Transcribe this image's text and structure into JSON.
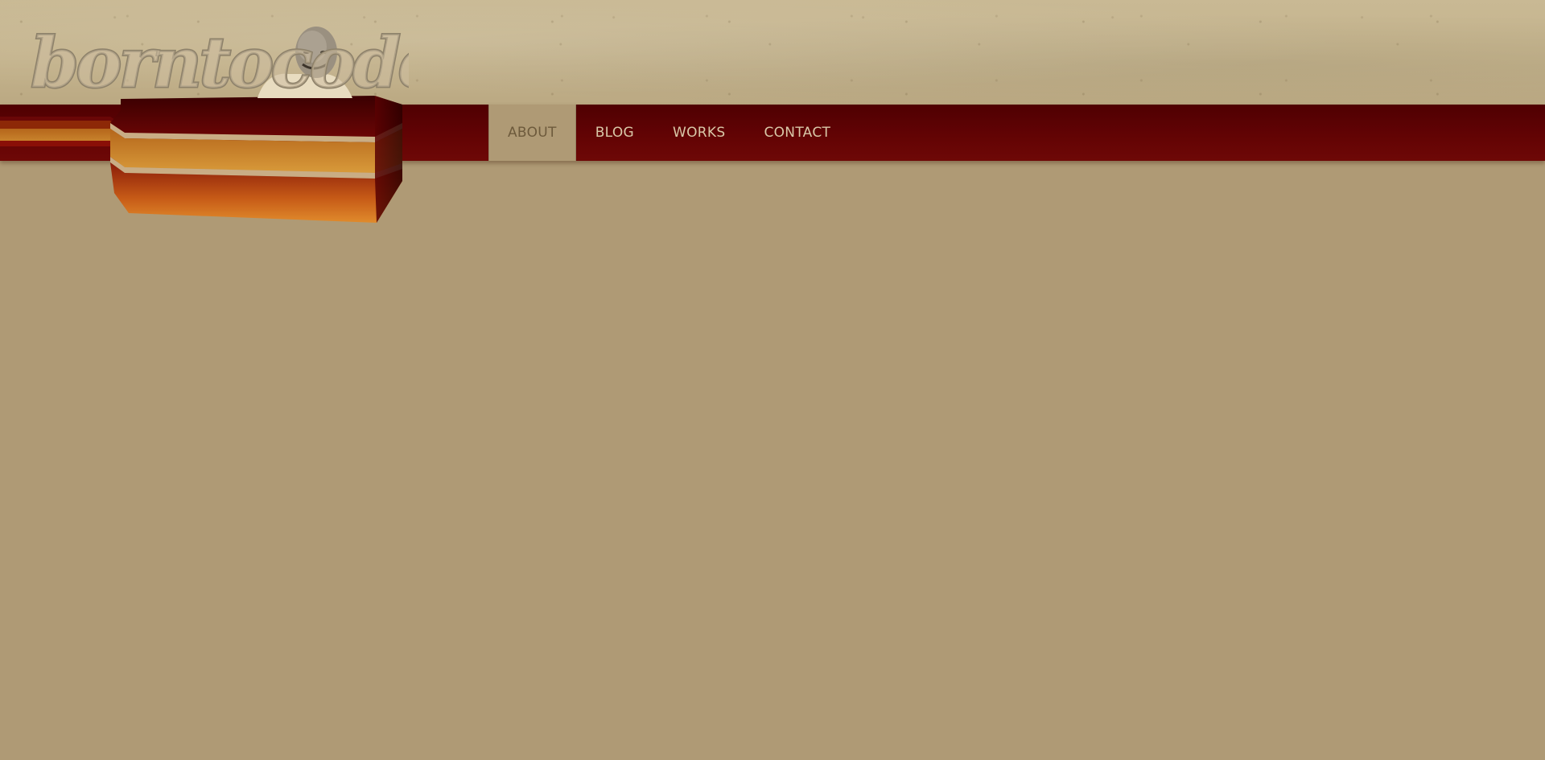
{
  "brand": {
    "name": "borntocode",
    "logo_icon": "borntocode-logo",
    "photo_icon": "portrait-photo"
  },
  "nav": {
    "items": [
      {
        "label": "ABOUT",
        "active": true
      },
      {
        "label": "BLOG",
        "active": false
      },
      {
        "label": "WORKS",
        "active": false
      },
      {
        "label": "CONTACT",
        "active": false
      }
    ]
  },
  "colors": {
    "page_background": "#af9a75",
    "header_paper": "#c4b38c",
    "nav_red": "#620304",
    "stripe_orange": "#d38a22",
    "nav_text": "#d9c8a8",
    "nav_active_text": "#6d5a3c"
  }
}
